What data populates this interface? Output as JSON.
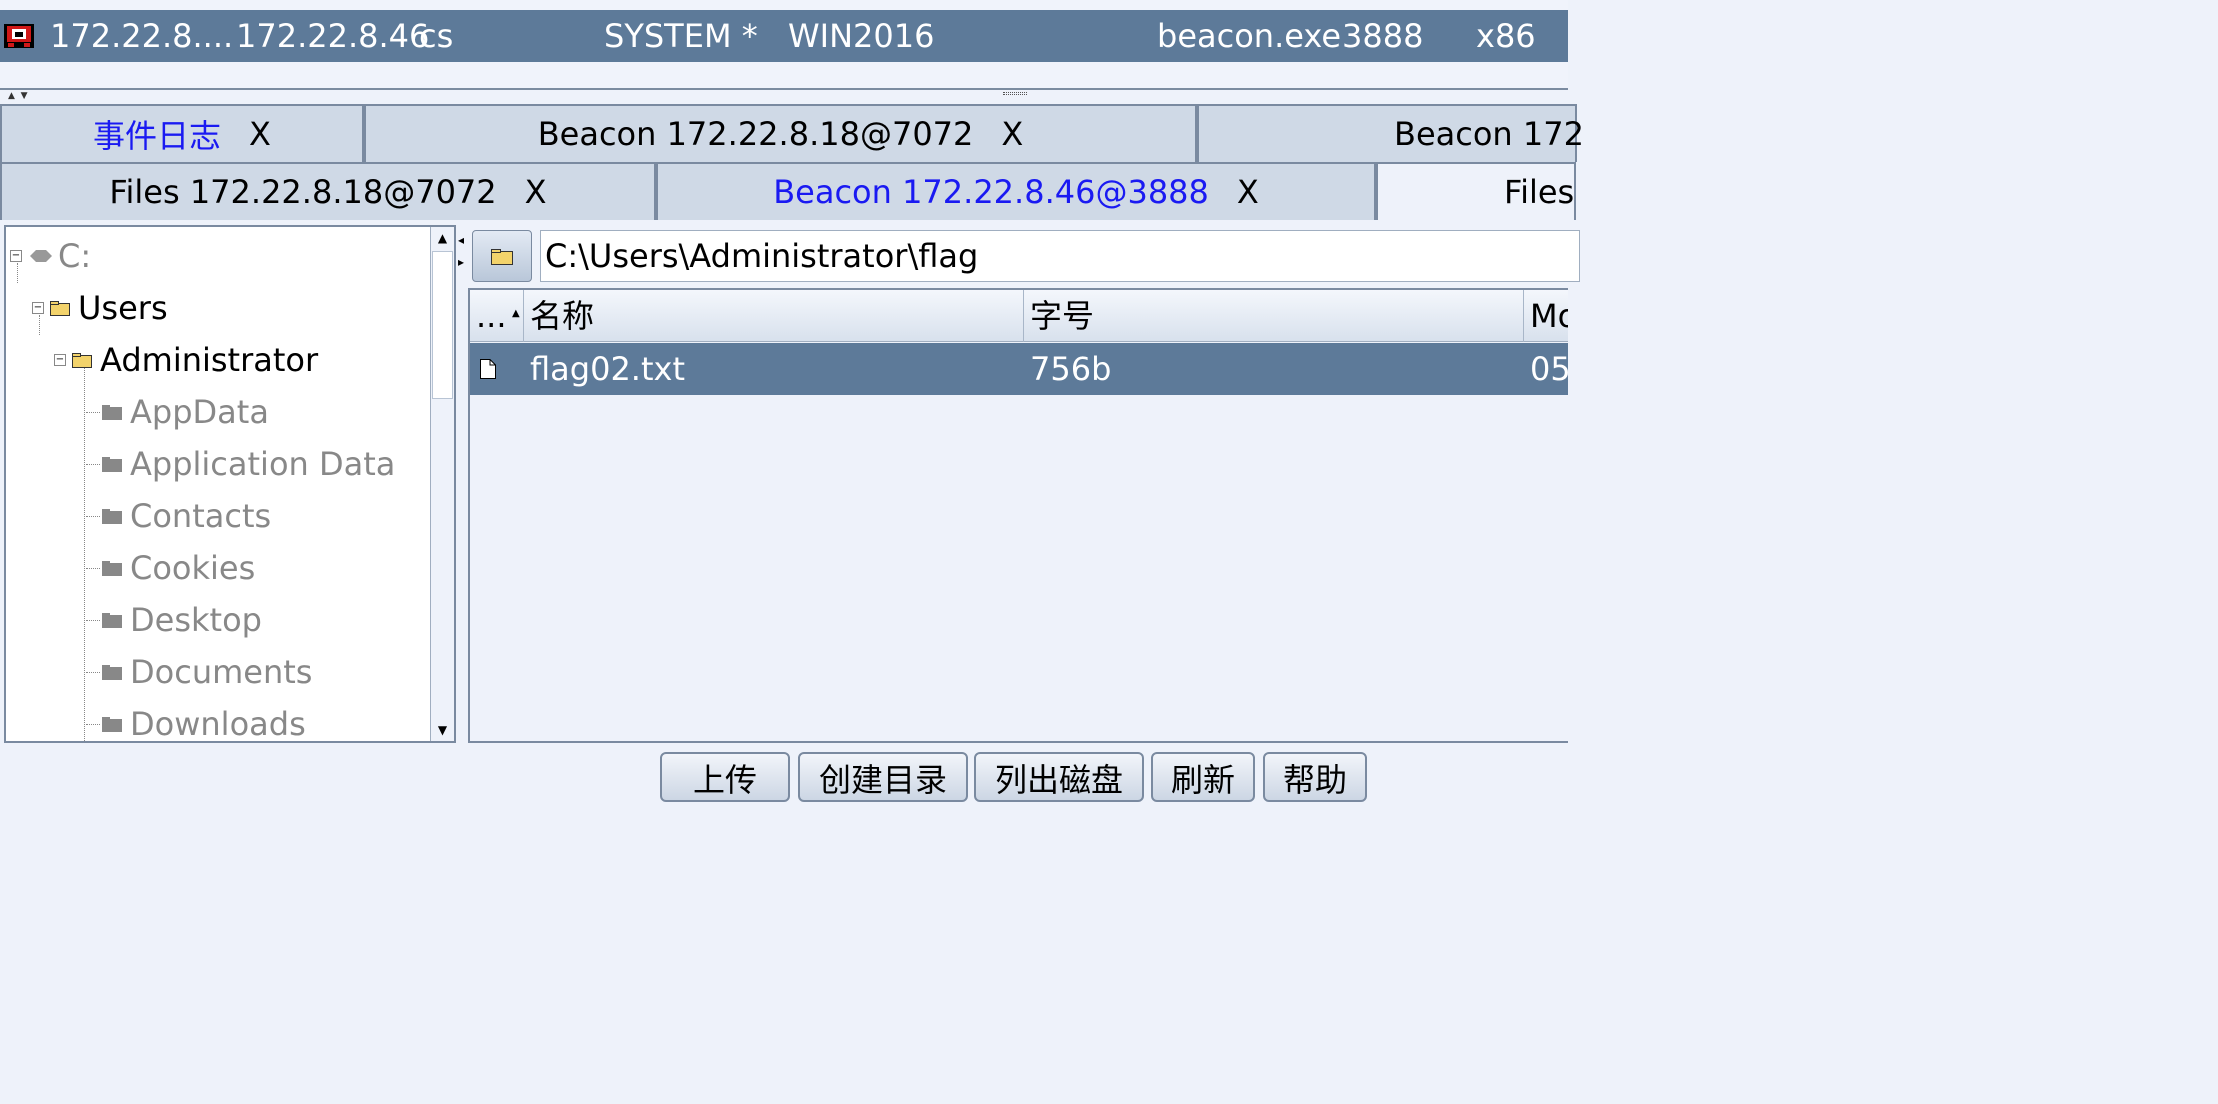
{
  "session": {
    "icon": "beacon-session-icon",
    "external_ip": "172.22.8....",
    "internal_ip": "172.22.8.46",
    "listener": "cs",
    "user": "SYSTEM *",
    "computer": "WIN2016",
    "process": "beacon.exe",
    "pid": "3888",
    "arch": "x86"
  },
  "tabs_row1": [
    {
      "label": "事件日志",
      "close": "X"
    },
    {
      "label": "Beacon 172.22.8.18@7072",
      "close": "X"
    },
    {
      "label": "Beacon 172"
    }
  ],
  "tabs_row2": [
    {
      "label": "Files 172.22.8.18@7072",
      "close": "X"
    },
    {
      "label": "Beacon 172.22.8.46@3888",
      "close": "X"
    },
    {
      "label": "Files"
    }
  ],
  "tree": {
    "drive": "C:",
    "users": "Users",
    "administrator": "Administrator",
    "children": [
      "AppData",
      "Application Data",
      "Contacts",
      "Cookies",
      "Desktop",
      "Documents",
      "Downloads"
    ]
  },
  "path": {
    "value": "C:\\Users\\Administrator\\flag"
  },
  "table": {
    "columns": [
      "...",
      "名称",
      "字号",
      "Mo"
    ],
    "rows": [
      {
        "name": "flag02.txt",
        "size": "756b",
        "modified": "05/"
      }
    ]
  },
  "buttons": {
    "upload": "上传",
    "mkdir": "创建目录",
    "list_drives": "列出磁盘",
    "refresh": "刷新",
    "help": "帮助"
  },
  "colors": {
    "session_bar": "#5d7a99",
    "selected_row": "#5d7a99",
    "tab_bg": "#cfd9e6",
    "active_tab_text": "#1a1af2"
  }
}
